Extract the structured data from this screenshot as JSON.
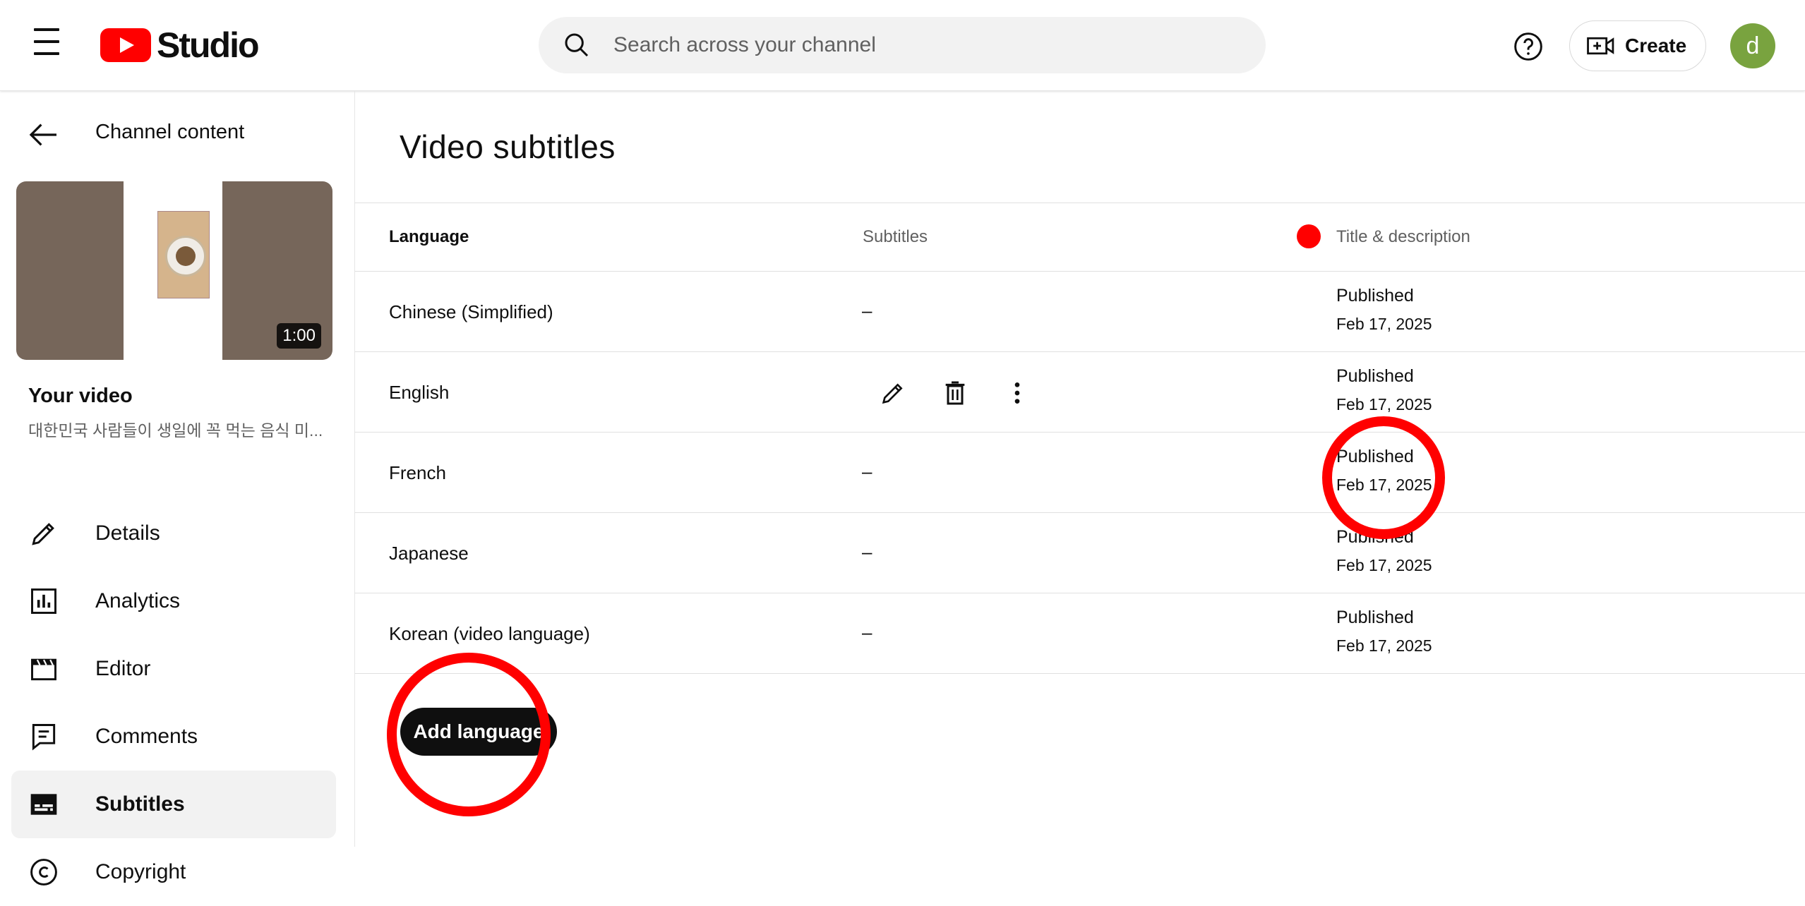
{
  "header": {
    "logo_text": "Studio",
    "search_placeholder": "Search across your channel",
    "create_label": "Create",
    "avatar_letter": "d"
  },
  "sidebar": {
    "back_label": "Channel content",
    "video_duration": "1:00",
    "your_video_label": "Your video",
    "video_title": "대한민국 사람들이 생일에 꼭 먹는 음식 미...",
    "items": [
      {
        "label": "Details",
        "icon": "pencil-icon"
      },
      {
        "label": "Analytics",
        "icon": "analytics-icon"
      },
      {
        "label": "Editor",
        "icon": "clapper-icon"
      },
      {
        "label": "Comments",
        "icon": "comments-icon"
      },
      {
        "label": "Subtitles",
        "icon": "subtitles-icon",
        "active": true
      },
      {
        "label": "Copyright",
        "icon": "copyright-icon"
      }
    ]
  },
  "main": {
    "title": "Video subtitles",
    "columns": {
      "language": "Language",
      "subtitles": "Subtitles",
      "title_description": "Title & description"
    },
    "rows": [
      {
        "language": "Chinese (Simplified)",
        "subtitles": "–",
        "status": "Published",
        "date": "Feb 17, 2025"
      },
      {
        "language": "English",
        "subtitles": "",
        "status": "Published",
        "date": "Feb 17, 2025"
      },
      {
        "language": "French",
        "subtitles": "–",
        "status": "Published",
        "date": "Feb 17, 2025"
      },
      {
        "language": "Japanese",
        "subtitles": "–",
        "status": "Published",
        "date": "Feb 17, 2025"
      },
      {
        "language": "Korean (video language)",
        "subtitles": "–",
        "status": "Published",
        "date": "Feb 17, 2025"
      }
    ],
    "add_language_label": "Add language"
  },
  "colors": {
    "brand_red": "#ff0000",
    "annotation_ring": "#ff0000",
    "avatar_bg": "#79a33f"
  }
}
